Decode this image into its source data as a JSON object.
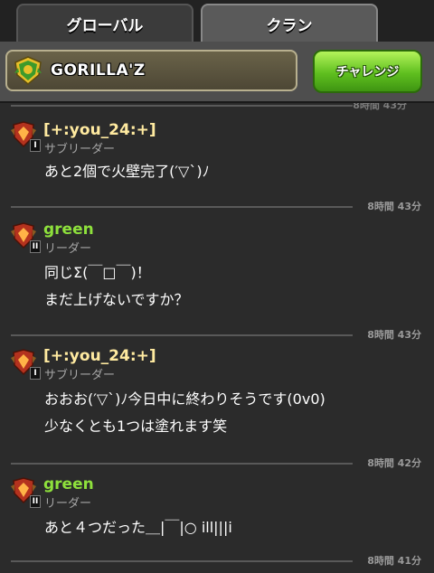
{
  "tabs": {
    "global": "グローバル",
    "clan": "クラン"
  },
  "header": {
    "clan_name": "GORILLA'Z",
    "challenge": "チャレンジ"
  },
  "top_partial_time": "8時間 43分",
  "messages": [
    {
      "user": "[+:you_24:+]",
      "role": "サブリーダー",
      "rank": "I",
      "lines": [
        "あと2個で火壁完了(′▽`)ﾉ"
      ],
      "time": "8時間 43分"
    },
    {
      "user": "green",
      "role": "リーダー",
      "rank": "II",
      "lines": [
        "同じΣ(￣□￣)！",
        "まだ上げないですか？"
      ],
      "time": "8時間 43分"
    },
    {
      "user": "[+:you_24:+]",
      "role": "サブリーダー",
      "rank": "I",
      "lines": [
        "おおお(′▽`)ﾉ今日中に終わりそうです(0v0)",
        "少なくとも1つは塗れます笑"
      ],
      "time": "8時間 42分"
    },
    {
      "user": "green",
      "role": "リーダー",
      "rank": "II",
      "lines": [
        "あと４つだった＿|￣|○ ill|||i"
      ],
      "time": "8時間 41分"
    }
  ],
  "colors": {
    "yellow_name": "#ffeaa0",
    "green_name": "#8ee03c",
    "challenge_green": "#5fbf1f"
  }
}
